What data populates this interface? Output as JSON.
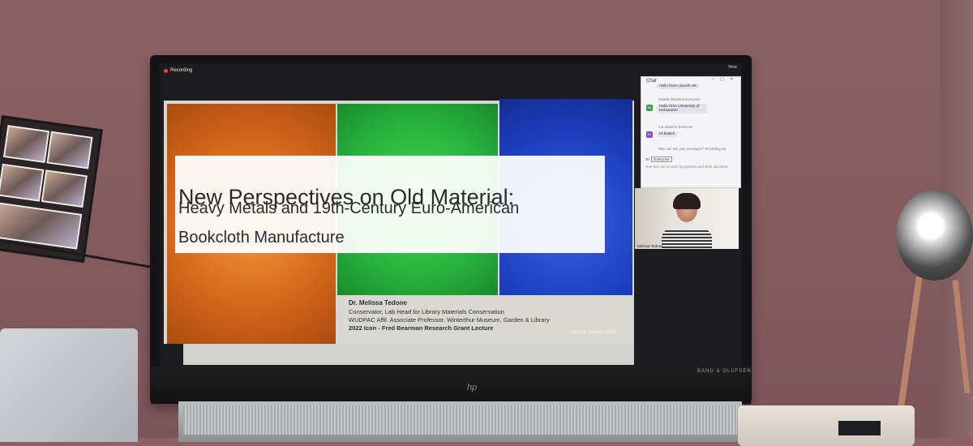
{
  "recording": {
    "label": "Recording"
  },
  "view": {
    "label": "View"
  },
  "slide": {
    "title_line1": "New Perspectives on Old Material:",
    "title_line2": "Heavy Metals and 19th-Century Euro-American",
    "title_line3": "Bookcloth Manufacture",
    "presenter": "Dr. Melissa Tedone",
    "role_line1": "Conservator, Lab Head for Library Materials Conservation",
    "role_line2": "WUDPAC Affil. Associate Professor, Winterthur Museum, Garden & Library",
    "lecture": "2022 Icon - Fred Bearman Research Grant Lecture",
    "footer": "Melissa Tedone 2022"
  },
  "chat": {
    "title": "Chat",
    "messages": [
      {
        "meta": "",
        "text": "Hello from Lincoln UK"
      },
      {
        "meta": "Isabella Morais to Everyone",
        "initials": "IM",
        "text": "Hello from University of Delaware!!"
      },
      {
        "meta": "Kat Sawel to Everyone",
        "initials": "KI",
        "text": "Hi Katie!!"
      }
    ],
    "who_can_see": "Who can see your messages? Recording On",
    "to_label": "To:",
    "to_value": "Everyone",
    "hint": "Your text can be seen by panelists and other attendees"
  },
  "video": {
    "name": "Melissa Tedone"
  },
  "monitor": {
    "brand": "BANG & OLUFSEN",
    "logo": "hp"
  }
}
